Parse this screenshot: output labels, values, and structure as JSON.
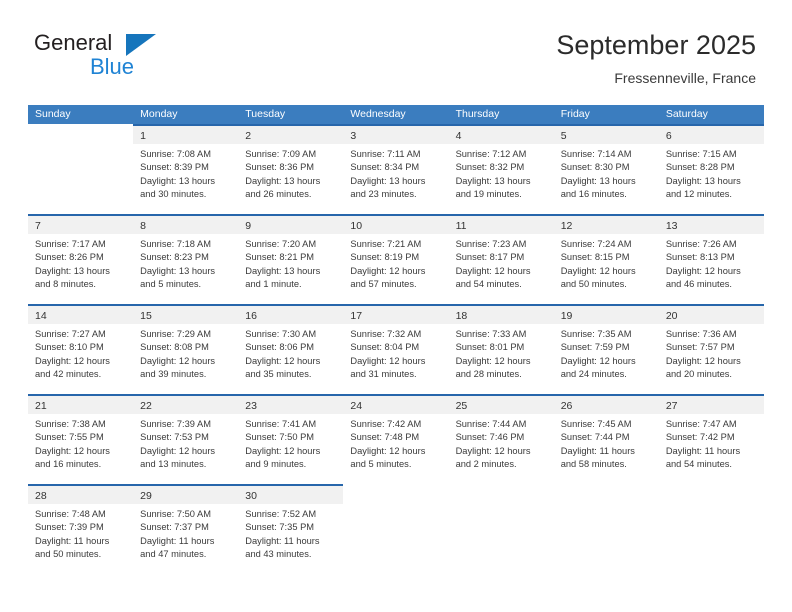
{
  "brand": {
    "name_part1": "General",
    "name_part2": "Blue",
    "triangle_color": "#1675bc",
    "blue_color": "#1f83d4"
  },
  "header": {
    "month_title": "September 2025",
    "location": "Fressenneville, France"
  },
  "colors": {
    "header_blue": "#3b7dbf",
    "row_divider_blue": "#2766ab",
    "number_band_gray": "#f1f1f1",
    "text": "#333333"
  },
  "weekdays": [
    "Sunday",
    "Monday",
    "Tuesday",
    "Wednesday",
    "Thursday",
    "Friday",
    "Saturday"
  ],
  "weeks": [
    [
      {
        "day": "",
        "sunrise": "",
        "sunset": "",
        "daylight_1": "",
        "daylight_2": ""
      },
      {
        "day": "1",
        "sunrise": "Sunrise: 7:08 AM",
        "sunset": "Sunset: 8:39 PM",
        "daylight_1": "Daylight: 13 hours",
        "daylight_2": "and 30 minutes."
      },
      {
        "day": "2",
        "sunrise": "Sunrise: 7:09 AM",
        "sunset": "Sunset: 8:36 PM",
        "daylight_1": "Daylight: 13 hours",
        "daylight_2": "and 26 minutes."
      },
      {
        "day": "3",
        "sunrise": "Sunrise: 7:11 AM",
        "sunset": "Sunset: 8:34 PM",
        "daylight_1": "Daylight: 13 hours",
        "daylight_2": "and 23 minutes."
      },
      {
        "day": "4",
        "sunrise": "Sunrise: 7:12 AM",
        "sunset": "Sunset: 8:32 PM",
        "daylight_1": "Daylight: 13 hours",
        "daylight_2": "and 19 minutes."
      },
      {
        "day": "5",
        "sunrise": "Sunrise: 7:14 AM",
        "sunset": "Sunset: 8:30 PM",
        "daylight_1": "Daylight: 13 hours",
        "daylight_2": "and 16 minutes."
      },
      {
        "day": "6",
        "sunrise": "Sunrise: 7:15 AM",
        "sunset": "Sunset: 8:28 PM",
        "daylight_1": "Daylight: 13 hours",
        "daylight_2": "and 12 minutes."
      }
    ],
    [
      {
        "day": "7",
        "sunrise": "Sunrise: 7:17 AM",
        "sunset": "Sunset: 8:26 PM",
        "daylight_1": "Daylight: 13 hours",
        "daylight_2": "and 8 minutes."
      },
      {
        "day": "8",
        "sunrise": "Sunrise: 7:18 AM",
        "sunset": "Sunset: 8:23 PM",
        "daylight_1": "Daylight: 13 hours",
        "daylight_2": "and 5 minutes."
      },
      {
        "day": "9",
        "sunrise": "Sunrise: 7:20 AM",
        "sunset": "Sunset: 8:21 PM",
        "daylight_1": "Daylight: 13 hours",
        "daylight_2": "and 1 minute."
      },
      {
        "day": "10",
        "sunrise": "Sunrise: 7:21 AM",
        "sunset": "Sunset: 8:19 PM",
        "daylight_1": "Daylight: 12 hours",
        "daylight_2": "and 57 minutes."
      },
      {
        "day": "11",
        "sunrise": "Sunrise: 7:23 AM",
        "sunset": "Sunset: 8:17 PM",
        "daylight_1": "Daylight: 12 hours",
        "daylight_2": "and 54 minutes."
      },
      {
        "day": "12",
        "sunrise": "Sunrise: 7:24 AM",
        "sunset": "Sunset: 8:15 PM",
        "daylight_1": "Daylight: 12 hours",
        "daylight_2": "and 50 minutes."
      },
      {
        "day": "13",
        "sunrise": "Sunrise: 7:26 AM",
        "sunset": "Sunset: 8:13 PM",
        "daylight_1": "Daylight: 12 hours",
        "daylight_2": "and 46 minutes."
      }
    ],
    [
      {
        "day": "14",
        "sunrise": "Sunrise: 7:27 AM",
        "sunset": "Sunset: 8:10 PM",
        "daylight_1": "Daylight: 12 hours",
        "daylight_2": "and 42 minutes."
      },
      {
        "day": "15",
        "sunrise": "Sunrise: 7:29 AM",
        "sunset": "Sunset: 8:08 PM",
        "daylight_1": "Daylight: 12 hours",
        "daylight_2": "and 39 minutes."
      },
      {
        "day": "16",
        "sunrise": "Sunrise: 7:30 AM",
        "sunset": "Sunset: 8:06 PM",
        "daylight_1": "Daylight: 12 hours",
        "daylight_2": "and 35 minutes."
      },
      {
        "day": "17",
        "sunrise": "Sunrise: 7:32 AM",
        "sunset": "Sunset: 8:04 PM",
        "daylight_1": "Daylight: 12 hours",
        "daylight_2": "and 31 minutes."
      },
      {
        "day": "18",
        "sunrise": "Sunrise: 7:33 AM",
        "sunset": "Sunset: 8:01 PM",
        "daylight_1": "Daylight: 12 hours",
        "daylight_2": "and 28 minutes."
      },
      {
        "day": "19",
        "sunrise": "Sunrise: 7:35 AM",
        "sunset": "Sunset: 7:59 PM",
        "daylight_1": "Daylight: 12 hours",
        "daylight_2": "and 24 minutes."
      },
      {
        "day": "20",
        "sunrise": "Sunrise: 7:36 AM",
        "sunset": "Sunset: 7:57 PM",
        "daylight_1": "Daylight: 12 hours",
        "daylight_2": "and 20 minutes."
      }
    ],
    [
      {
        "day": "21",
        "sunrise": "Sunrise: 7:38 AM",
        "sunset": "Sunset: 7:55 PM",
        "daylight_1": "Daylight: 12 hours",
        "daylight_2": "and 16 minutes."
      },
      {
        "day": "22",
        "sunrise": "Sunrise: 7:39 AM",
        "sunset": "Sunset: 7:53 PM",
        "daylight_1": "Daylight: 12 hours",
        "daylight_2": "and 13 minutes."
      },
      {
        "day": "23",
        "sunrise": "Sunrise: 7:41 AM",
        "sunset": "Sunset: 7:50 PM",
        "daylight_1": "Daylight: 12 hours",
        "daylight_2": "and 9 minutes."
      },
      {
        "day": "24",
        "sunrise": "Sunrise: 7:42 AM",
        "sunset": "Sunset: 7:48 PM",
        "daylight_1": "Daylight: 12 hours",
        "daylight_2": "and 5 minutes."
      },
      {
        "day": "25",
        "sunrise": "Sunrise: 7:44 AM",
        "sunset": "Sunset: 7:46 PM",
        "daylight_1": "Daylight: 12 hours",
        "daylight_2": "and 2 minutes."
      },
      {
        "day": "26",
        "sunrise": "Sunrise: 7:45 AM",
        "sunset": "Sunset: 7:44 PM",
        "daylight_1": "Daylight: 11 hours",
        "daylight_2": "and 58 minutes."
      },
      {
        "day": "27",
        "sunrise": "Sunrise: 7:47 AM",
        "sunset": "Sunset: 7:42 PM",
        "daylight_1": "Daylight: 11 hours",
        "daylight_2": "and 54 minutes."
      }
    ],
    [
      {
        "day": "28",
        "sunrise": "Sunrise: 7:48 AM",
        "sunset": "Sunset: 7:39 PM",
        "daylight_1": "Daylight: 11 hours",
        "daylight_2": "and 50 minutes."
      },
      {
        "day": "29",
        "sunrise": "Sunrise: 7:50 AM",
        "sunset": "Sunset: 7:37 PM",
        "daylight_1": "Daylight: 11 hours",
        "daylight_2": "and 47 minutes."
      },
      {
        "day": "30",
        "sunrise": "Sunrise: 7:52 AM",
        "sunset": "Sunset: 7:35 PM",
        "daylight_1": "Daylight: 11 hours",
        "daylight_2": "and 43 minutes."
      },
      {
        "day": "",
        "sunrise": "",
        "sunset": "",
        "daylight_1": "",
        "daylight_2": ""
      },
      {
        "day": "",
        "sunrise": "",
        "sunset": "",
        "daylight_1": "",
        "daylight_2": ""
      },
      {
        "day": "",
        "sunrise": "",
        "sunset": "",
        "daylight_1": "",
        "daylight_2": ""
      },
      {
        "day": "",
        "sunrise": "",
        "sunset": "",
        "daylight_1": "",
        "daylight_2": ""
      }
    ]
  ]
}
